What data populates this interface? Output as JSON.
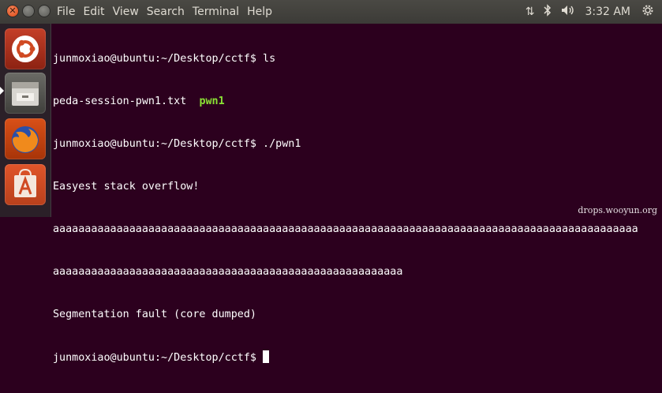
{
  "menubar": {
    "items": [
      "File",
      "Edit",
      "View",
      "Search",
      "Terminal",
      "Help"
    ]
  },
  "indicators": {
    "clock": "3:32 AM",
    "icons": [
      "network-icon",
      "bluetooth-icon",
      "volume-icon",
      "gear-icon"
    ]
  },
  "launcher": {
    "items": [
      "ubuntu-dash",
      "files",
      "firefox",
      "ubuntu-software"
    ]
  },
  "terminal": {
    "lines": [
      {
        "prompt": "junmoxiao@ubuntu:~/Desktop/cctf$ ",
        "command": "ls"
      },
      {
        "text": "peda-session-pwn1.txt  ",
        "exec": "pwn1"
      },
      {
        "prompt": "junmoxiao@ubuntu:~/Desktop/cctf$ ",
        "command": "./pwn1"
      },
      {
        "text": "Easyest stack overflow!"
      },
      {
        "text": "aaaaaaaaaaaaaaaaaaaaaaaaaaaaaaaaaaaaaaaaaaaaaaaaaaaaaaaaaaaaaaaaaaaaaaaaaaaaaaaaaaaaaaaaaaaaaaaaaaaaaaaaaaaaaaaaaaaaaaaaaaaa"
      },
      {
        "text": "Segmentation fault (core dumped)"
      },
      {
        "prompt": "junmoxiao@ubuntu:~/Desktop/cctf$ ",
        "command": ""
      }
    ],
    "wrapped_a_line_1": "aaaaaaaaaaaaaaaaaaaaaaaaaaaaaaaaaaaaaaaaaaaaaaaaaaaaaaaaaaaaaaaaaaaaaaaaaaaaaaaaaaaaaaaaaaaa",
    "wrapped_a_line_2": "aaaaaaaaaaaaaaaaaaaaaaaaaaaaaaaaaaaaaaaaaaaaaaaaaaaaaaa",
    "exec_color": "#8ae234",
    "background": "#2c001e"
  },
  "watermark": "drops.wooyun.org"
}
